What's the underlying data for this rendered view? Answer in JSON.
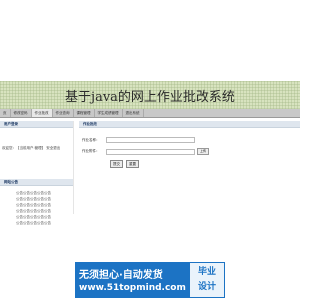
{
  "header": {
    "title": "基于java的网上作业批改系统"
  },
  "nav": {
    "items": [
      "页",
      "修改密码",
      "作业批改",
      "作业查询",
      "课程管理",
      "学生成绩管理",
      "退出系统"
    ],
    "active_index": 2
  },
  "sidebar": {
    "user_panel_title": "用户登录",
    "user_text": "欢迎您：【当前用户:管理】  安全退出",
    "links_panel_title": "网站公告",
    "links": [
      "公告公告公告公告公告",
      "公告公告公告公告公告",
      "公告公告公告公告公告",
      "公告公告公告公告公告",
      "公告公告公告公告公告",
      "公告公告公告公告公告"
    ]
  },
  "form": {
    "panel_title": "作业批改",
    "field1_label": "作业名称：",
    "field1_value": "",
    "field2_label": "作业附件：",
    "field2_value": "",
    "browse_label": "上传",
    "submit_label": "提交",
    "reset_label": "重置"
  },
  "watermark": {
    "line1": "无须担心·自动发货",
    "line2": "www.51topmind.com",
    "badge_line1": "毕业",
    "badge_line2": "设计"
  }
}
